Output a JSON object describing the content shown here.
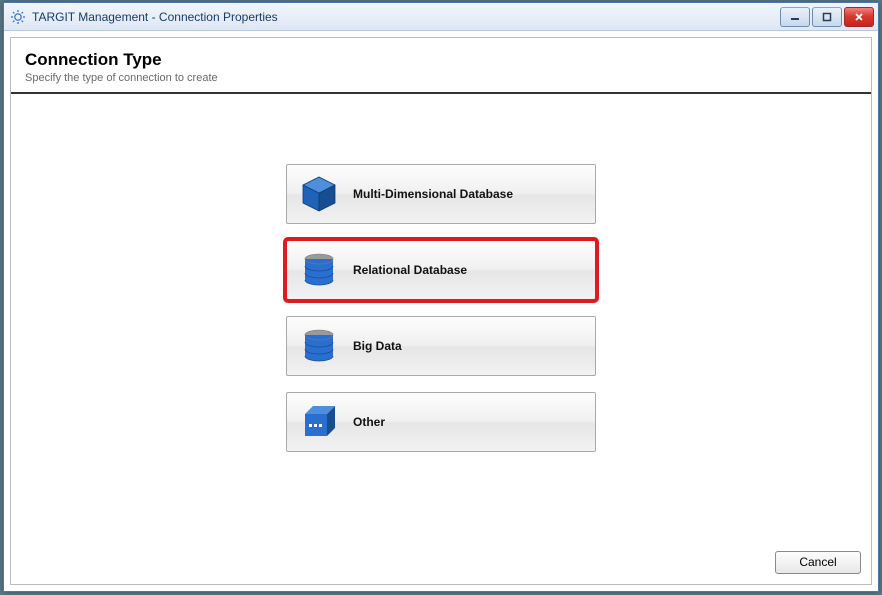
{
  "window": {
    "title": "TARGIT Management - Connection Properties"
  },
  "header": {
    "title": "Connection Type",
    "subtitle": "Specify the type of connection to create"
  },
  "options": {
    "multidimensional": {
      "label": "Multi-Dimensional Database",
      "highlighted": false
    },
    "relational": {
      "label": "Relational Database",
      "highlighted": true
    },
    "bigdata": {
      "label": "Big Data",
      "highlighted": false
    },
    "other": {
      "label": "Other",
      "highlighted": false
    }
  },
  "footer": {
    "cancel_label": "Cancel"
  },
  "colors": {
    "highlight": "#e01b1b",
    "icon_blue": "#1f63b8",
    "icon_blue_light": "#4d8fdd",
    "icon_gray": "#9a9a9a"
  }
}
